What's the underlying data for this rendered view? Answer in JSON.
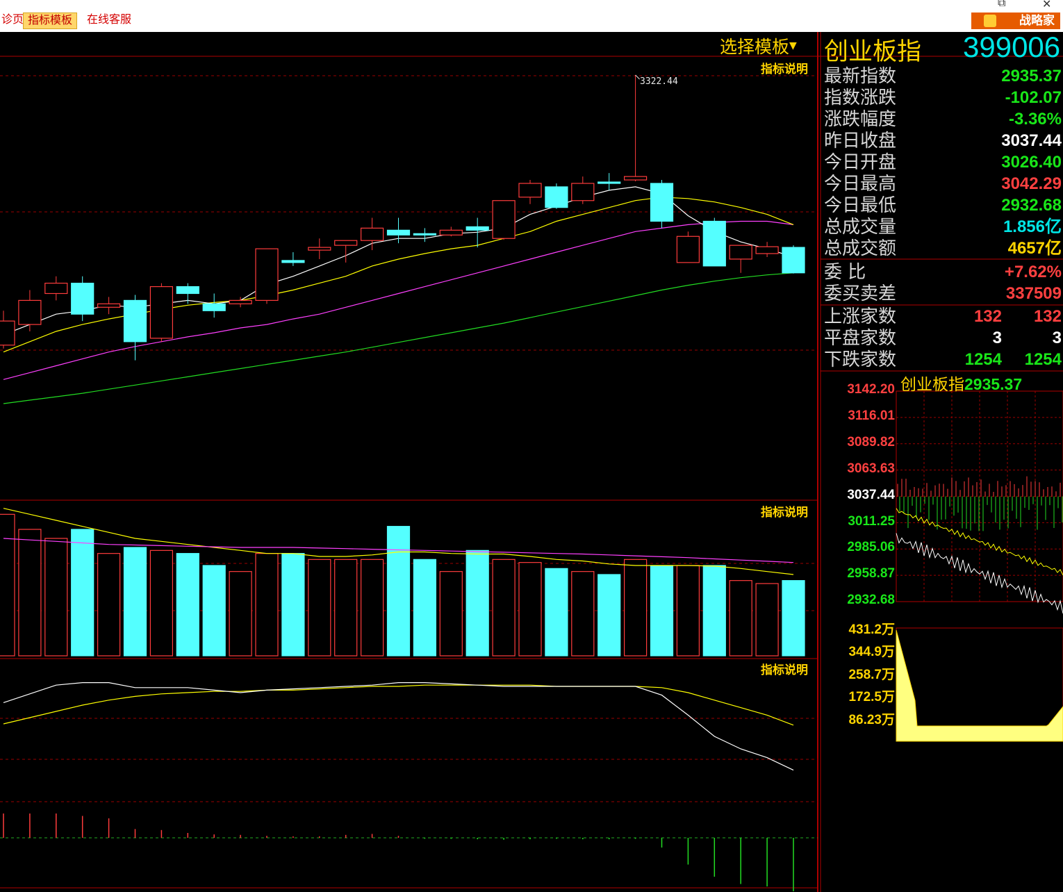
{
  "tabs": [
    {
      "label": "诊页",
      "active": false
    },
    {
      "label": "指标模板",
      "active": true
    },
    {
      "label": "在线客服",
      "active": false
    }
  ],
  "brand_button": "战略家",
  "window_controls": {
    "restore": "⧉",
    "close": "✕"
  },
  "select_template": "选择模板",
  "indicator_explain": "指标说明",
  "index": {
    "name": "创业板指",
    "code": "399006"
  },
  "high_marker": "3322.44",
  "quote": [
    {
      "label": "最新指数",
      "value": "2935.37",
      "color": "#19e619"
    },
    {
      "label": "指数涨跌",
      "value": "-102.07",
      "color": "#19e619"
    },
    {
      "label": "涨跌幅度",
      "value": "-3.36%",
      "color": "#19e619"
    },
    {
      "label": "昨日收盘",
      "value": "3037.44",
      "color": "#ffffff"
    },
    {
      "label": "今日开盘",
      "value": "3026.40",
      "color": "#19e619"
    },
    {
      "label": "今日最高",
      "value": "3042.29",
      "color": "#ff4040"
    },
    {
      "label": "今日最低",
      "value": "2932.68",
      "color": "#19e619"
    },
    {
      "label": "总成交量",
      "value": "1.856亿",
      "color": "#00e6e6"
    },
    {
      "label": "总成交额",
      "value": "4657亿",
      "color": "#ffd400"
    }
  ],
  "order": [
    {
      "label": "委      比",
      "value": "+7.62%",
      "color": "#ff4040"
    },
    {
      "label": "委买卖差",
      "value": "337509",
      "color": "#ff4040"
    }
  ],
  "breadth": [
    {
      "label": "上涨家数",
      "v1": "132",
      "v2": "132",
      "color": "#ff4040"
    },
    {
      "label": "平盘家数",
      "v1": "3",
      "v2": "3",
      "color": "#ffffff"
    },
    {
      "label": "下跌家数",
      "v1": "1254",
      "v2": "1254",
      "color": "#19e619"
    }
  ],
  "mini": {
    "title": "创业板指",
    "price": "2935.37",
    "price_axis": [
      {
        "v": "3142.20",
        "c": "#ff4040"
      },
      {
        "v": "3116.01",
        "c": "#ff4040"
      },
      {
        "v": "3089.82",
        "c": "#ff4040"
      },
      {
        "v": "3063.63",
        "c": "#ff4040"
      },
      {
        "v": "3037.44",
        "c": "#ffffff"
      },
      {
        "v": "3011.25",
        "c": "#19e619"
      },
      {
        "v": "2985.06",
        "c": "#19e619"
      },
      {
        "v": "2958.87",
        "c": "#19e619"
      },
      {
        "v": "2932.68",
        "c": "#19e619"
      }
    ],
    "vol_axis": [
      "431.2万",
      "344.9万",
      "258.7万",
      "172.5万",
      "86.23万"
    ]
  },
  "colors": {
    "up": "#ff3c3c",
    "down": "#54ffff",
    "ma5": "#ffffff",
    "ma10": "#ffff00",
    "ma20": "#ff40ff",
    "ma60": "#22dd22",
    "grid": "#9b0000"
  },
  "chart_data": {
    "type": "candlestick",
    "title": "",
    "candles": [
      {
        "o": 2930,
        "h": 2980,
        "l": 2925,
        "c": 2965
      },
      {
        "o": 2960,
        "h": 3010,
        "l": 2950,
        "c": 2995
      },
      {
        "o": 3005,
        "h": 3030,
        "l": 2995,
        "c": 3020
      },
      {
        "o": 3020,
        "h": 3030,
        "l": 2965,
        "c": 2975
      },
      {
        "o": 2985,
        "h": 3000,
        "l": 2975,
        "c": 2990
      },
      {
        "o": 2995,
        "h": 3003,
        "l": 2908,
        "c": 2935
      },
      {
        "o": 2940,
        "h": 3020,
        "l": 2935,
        "c": 3015
      },
      {
        "o": 3015,
        "h": 3020,
        "l": 2990,
        "c": 3005
      },
      {
        "o": 2990,
        "h": 3005,
        "l": 2970,
        "c": 2980
      },
      {
        "o": 2990,
        "h": 3000,
        "l": 2985,
        "c": 2995
      },
      {
        "o": 2995,
        "h": 3070,
        "l": 2990,
        "c": 3070
      },
      {
        "o": 3053,
        "h": 3065,
        "l": 3045,
        "c": 3050
      },
      {
        "o": 3068,
        "h": 3085,
        "l": 3055,
        "c": 3072
      },
      {
        "o": 3075,
        "h": 3078,
        "l": 3050,
        "c": 3082
      },
      {
        "o": 3082,
        "h": 3115,
        "l": 3068,
        "c": 3100
      },
      {
        "o": 3097,
        "h": 3115,
        "l": 3078,
        "c": 3090
      },
      {
        "o": 3092,
        "h": 3100,
        "l": 3080,
        "c": 3090
      },
      {
        "o": 3090,
        "h": 3102,
        "l": 3088,
        "c": 3097
      },
      {
        "o": 3102,
        "h": 3115,
        "l": 3072,
        "c": 3097
      },
      {
        "o": 3085,
        "h": 3138,
        "l": 3083,
        "c": 3140
      },
      {
        "o": 3145,
        "h": 3170,
        "l": 3135,
        "c": 3165
      },
      {
        "o": 3160,
        "h": 3165,
        "l": 3128,
        "c": 3130
      },
      {
        "o": 3140,
        "h": 3175,
        "l": 3135,
        "c": 3165
      },
      {
        "o": 3167,
        "h": 3180,
        "l": 3155,
        "c": 3165
      },
      {
        "o": 3170,
        "h": 3322.44,
        "l": 3168,
        "c": 3175
      },
      {
        "o": 3165,
        "h": 3170,
        "l": 3100,
        "c": 3110
      },
      {
        "o": 3050,
        "h": 3095,
        "l": 3050,
        "c": 3088
      },
      {
        "o": 3110,
        "h": 3115,
        "l": 3045,
        "c": 3045
      },
      {
        "o": 3055,
        "h": 3075,
        "l": 3035,
        "c": 3075
      },
      {
        "o": 3063,
        "h": 3080,
        "l": 3058,
        "c": 3073
      },
      {
        "o": 3072,
        "h": 3075,
        "l": 3034,
        "c": 3035
      }
    ],
    "ma": {
      "ma5": [
        2945,
        2960,
        2975,
        2980,
        2988,
        2985,
        2990,
        2995,
        2990,
        2995,
        3018,
        3030,
        3045,
        3060,
        3078,
        3085,
        3085,
        3092,
        3094,
        3100,
        3120,
        3132,
        3145,
        3155,
        3160,
        3150,
        3118,
        3095,
        3080,
        3070,
        3058
      ],
      "ma10": [
        2920,
        2935,
        2950,
        2960,
        2968,
        2975,
        2982,
        2988,
        2992,
        2995,
        3002,
        3010,
        3020,
        3030,
        3045,
        3055,
        3063,
        3070,
        3075,
        3085,
        3095,
        3110,
        3120,
        3130,
        3140,
        3145,
        3143,
        3138,
        3130,
        3120,
        3105
      ],
      "ma20": [
        2880,
        2890,
        2900,
        2910,
        2920,
        2928,
        2935,
        2942,
        2948,
        2955,
        2960,
        2968,
        2975,
        2985,
        2995,
        3005,
        3015,
        3025,
        3035,
        3045,
        3055,
        3065,
        3075,
        3085,
        3095,
        3100,
        3105,
        3108,
        3110,
        3110,
        3105
      ],
      "ma60": [
        2845,
        2850,
        2855,
        2860,
        2866,
        2872,
        2878,
        2884,
        2890,
        2896,
        2902,
        2908,
        2914,
        2920,
        2927,
        2934,
        2941,
        2948,
        2955,
        2962,
        2970,
        2978,
        2986,
        2994,
        3002,
        3010,
        3017,
        3023,
        3028,
        3032,
        3035
      ]
    },
    "volume": [
      4.7,
      4.2,
      3.9,
      4.2,
      3.4,
      3.6,
      3.5,
      3.4,
      3.0,
      2.8,
      3.4,
      3.4,
      3.2,
      3.2,
      3.2,
      4.3,
      3.2,
      2.8,
      3.5,
      3.2,
      3.1,
      2.9,
      2.8,
      2.7,
      3.2,
      3.0,
      3.0,
      3.0,
      2.5,
      2.4,
      2.5
    ],
    "volume_ma": [
      4.9,
      4.7,
      4.5,
      4.3,
      4.1,
      3.9,
      3.8,
      3.7,
      3.6,
      3.5,
      3.4,
      3.4,
      3.3,
      3.3,
      3.35,
      3.45,
      3.45,
      3.4,
      3.38,
      3.38,
      3.3,
      3.2,
      3.15,
      3.05,
      3.0,
      3.0,
      3.0,
      2.98,
      2.9,
      2.8,
      2.7
    ],
    "volume_ma2": [
      3.9,
      3.85,
      3.8,
      3.75,
      3.7,
      3.68,
      3.66,
      3.64,
      3.62,
      3.6,
      3.6,
      3.6,
      3.58,
      3.56,
      3.54,
      3.52,
      3.5,
      3.48,
      3.46,
      3.44,
      3.42,
      3.4,
      3.38,
      3.35,
      3.32,
      3.29,
      3.26,
      3.22,
      3.18,
      3.14,
      3.1
    ],
    "oscillator": {
      "fast": [
        72,
        79,
        86,
        88,
        88,
        84,
        84,
        84,
        82,
        80,
        82,
        83,
        84,
        85,
        86,
        88,
        88,
        87,
        86,
        85,
        85,
        85,
        85,
        85,
        85,
        78,
        62,
        45,
        35,
        28,
        18
      ],
      "slow": [
        55,
        60,
        65,
        70,
        74,
        77,
        79,
        80,
        81,
        81,
        82,
        82,
        83,
        84,
        85,
        85,
        86,
        86,
        86,
        86,
        86,
        85,
        85,
        85,
        85,
        84,
        80,
        74,
        68,
        62,
        54
      ]
    },
    "macd": [
      0.5,
      0.5,
      0.5,
      0.45,
      0.4,
      0.18,
      0.16,
      0.1,
      0.07,
      0.06,
      0.04,
      0.03,
      0.03,
      0.06,
      0.08,
      0.04,
      -0.02,
      -0.02,
      -0.03,
      -0.04,
      -0.03,
      -0.02,
      -0.03,
      -0.03,
      -0.02,
      -0.2,
      -0.55,
      -0.8,
      -0.95,
      -1.0,
      -1.1
    ]
  }
}
